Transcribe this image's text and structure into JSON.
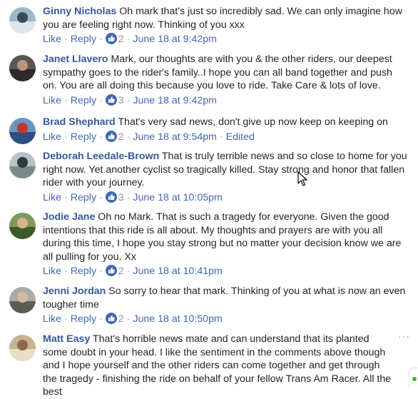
{
  "comments": [
    {
      "author": "Ginny Nicholas",
      "text": "Oh mark that's just so incredibly sad. We can only imagine how you are feeling right now. Thinking of you xxx",
      "like": "Like",
      "reply": "Reply",
      "reactions": "2",
      "time": "June 18 at 9:42pm",
      "edited": "",
      "avatar_colors": [
        "#9fb8c9",
        "#dfe6ea",
        "#3a4a5a"
      ]
    },
    {
      "author": "Janet Llavero",
      "text": "Mark, our thoughts are with you & the other riders, our deepest sympathy goes to the rider's family..I hope you can all band together and push on. You are all doing this because you love to ride. Take Care & lots of love.",
      "like": "Like",
      "reply": "Reply",
      "reactions": "3",
      "time": "June 18 at 9:42pm",
      "edited": "",
      "avatar_colors": [
        "#5a5650",
        "#2e2a28",
        "#b7957d"
      ]
    },
    {
      "author": "Brad Shephard",
      "text": "That's very sad news, don't give up now keep on keeping on",
      "like": "Like",
      "reply": "Reply",
      "reactions": "2",
      "time": "June 18 at 9:54pm",
      "edited": "Edited",
      "avatar_colors": [
        "#6f93c0",
        "#2d4f86",
        "#c0392b"
      ]
    },
    {
      "author": "Deborah Leedale-Brown",
      "text": "That is truly terrible news and so close to home for you right now. Yet another cyclist so tragically killed. Stay strong and honor that fallen rider with your journey.",
      "like": "Like",
      "reply": "Reply",
      "reactions": "3",
      "time": "June 18 at 10:05pm",
      "edited": "",
      "avatar_colors": [
        "#b7c3c8",
        "#7a8a86",
        "#2f3b3f"
      ]
    },
    {
      "author": "Jodie Jane",
      "text": "Oh no Mark. That is such a tragedy for everyone. Given the good intentions that this ride is all about. My thoughts and prayers are with you all during this time, I hope you stay strong but no matter your decision know we are all pulling for you. Xx",
      "like": "Like",
      "reply": "Reply",
      "reactions": "2",
      "time": "June 18 at 10:41pm",
      "edited": "",
      "avatar_colors": [
        "#7d9a5a",
        "#3f5a2a",
        "#d9b08c"
      ]
    },
    {
      "author": "Jenni Jordan",
      "text": "So sorry to hear that mark. Thinking of you at what is now an even tougher time",
      "like": "Like",
      "reply": "Reply",
      "reactions": "2",
      "time": "June 18 at 10:50pm",
      "edited": "",
      "avatar_colors": [
        "#a9a9a6",
        "#5e5b57",
        "#d7b89a"
      ]
    },
    {
      "author": "Matt Easy",
      "text": "That's horrible news mate and can understand that its planted some doubt in your head. I like the sentiment in the comments above though and I hope yourself and the other riders can come together and get through the tragedy - finishing the ride on behalf of your fellow Trans Am Racer. All the best",
      "like": "",
      "reply": "",
      "reactions": "",
      "time": "",
      "edited": "",
      "avatar_colors": [
        "#c7b48e",
        "#e8dcc4",
        "#8a6b4a"
      ]
    }
  ],
  "more_options": "···"
}
